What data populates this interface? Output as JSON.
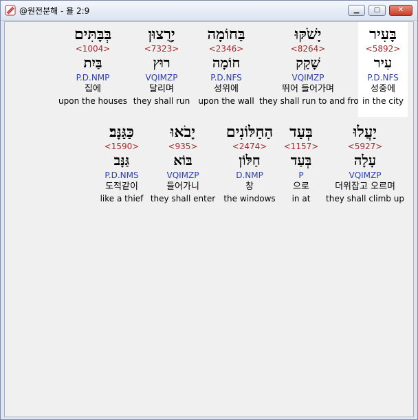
{
  "window": {
    "title": "@원전분해 - 욜 2:9",
    "min_glyph": "▁",
    "max_glyph": "▢",
    "close_glyph": "✕"
  },
  "rows": [
    [
      {
        "hebrew": "בְּבָּתִּים",
        "strongs": "<1004>",
        "lemma": "בַּיִת",
        "parse": "P.D.NMP",
        "korean": "집에",
        "english": "upon the houses"
      },
      {
        "hebrew": "יָרֻצוּן",
        "strongs": "<7323>",
        "lemma": "רוּץ",
        "parse": "VQIMZP",
        "korean": "달리며",
        "english": "they shall run"
      },
      {
        "hebrew": "בַּחוֹמָה",
        "strongs": "<2346>",
        "lemma": "חוֹמָה",
        "parse": "P.D.NFS",
        "korean": "성위에",
        "english": "upon the wall"
      },
      {
        "hebrew": "יָשֹׁקּוּ",
        "strongs": "<8264>",
        "lemma": "שָׁקַק",
        "parse": "VQIMZP",
        "korean": "뛰어 들어가며",
        "english": "they shall run to and fro"
      },
      {
        "hebrew": "בָּעִיר",
        "strongs": "<5892>",
        "lemma": "עִיר",
        "parse": "P.D.NFS",
        "korean": "성중에",
        "english": "in the city"
      }
    ],
    [
      {
        "hebrew": "כַּגַּנָּב׃",
        "strongs": "<1590>",
        "lemma": "גַּנָּב",
        "parse": "P.D.NMS",
        "korean": "도적같이",
        "english": "like a thief"
      },
      {
        "hebrew": "יָבֹאוּ",
        "strongs": "<935>",
        "lemma": "בּוֹא",
        "parse": "VQIMZP",
        "korean": "들어가니",
        "english": "they shall enter"
      },
      {
        "hebrew": "הַחַלּוֹנִים",
        "strongs": "<2474>",
        "lemma": "חַלּוֹן",
        "parse": "D.NMP",
        "korean": "창",
        "english": "the windows"
      },
      {
        "hebrew": "בְּעַד",
        "strongs": "<1157>",
        "lemma": "בְּעַד",
        "parse": "P",
        "korean": "으로",
        "english": "in at"
      },
      {
        "hebrew": "יַעֲלוּ",
        "strongs": "<5927>",
        "lemma": "עָלָה",
        "parse": "VQIMZP",
        "korean": "더위잡고 오르며",
        "english": "they shall climb up"
      }
    ]
  ]
}
